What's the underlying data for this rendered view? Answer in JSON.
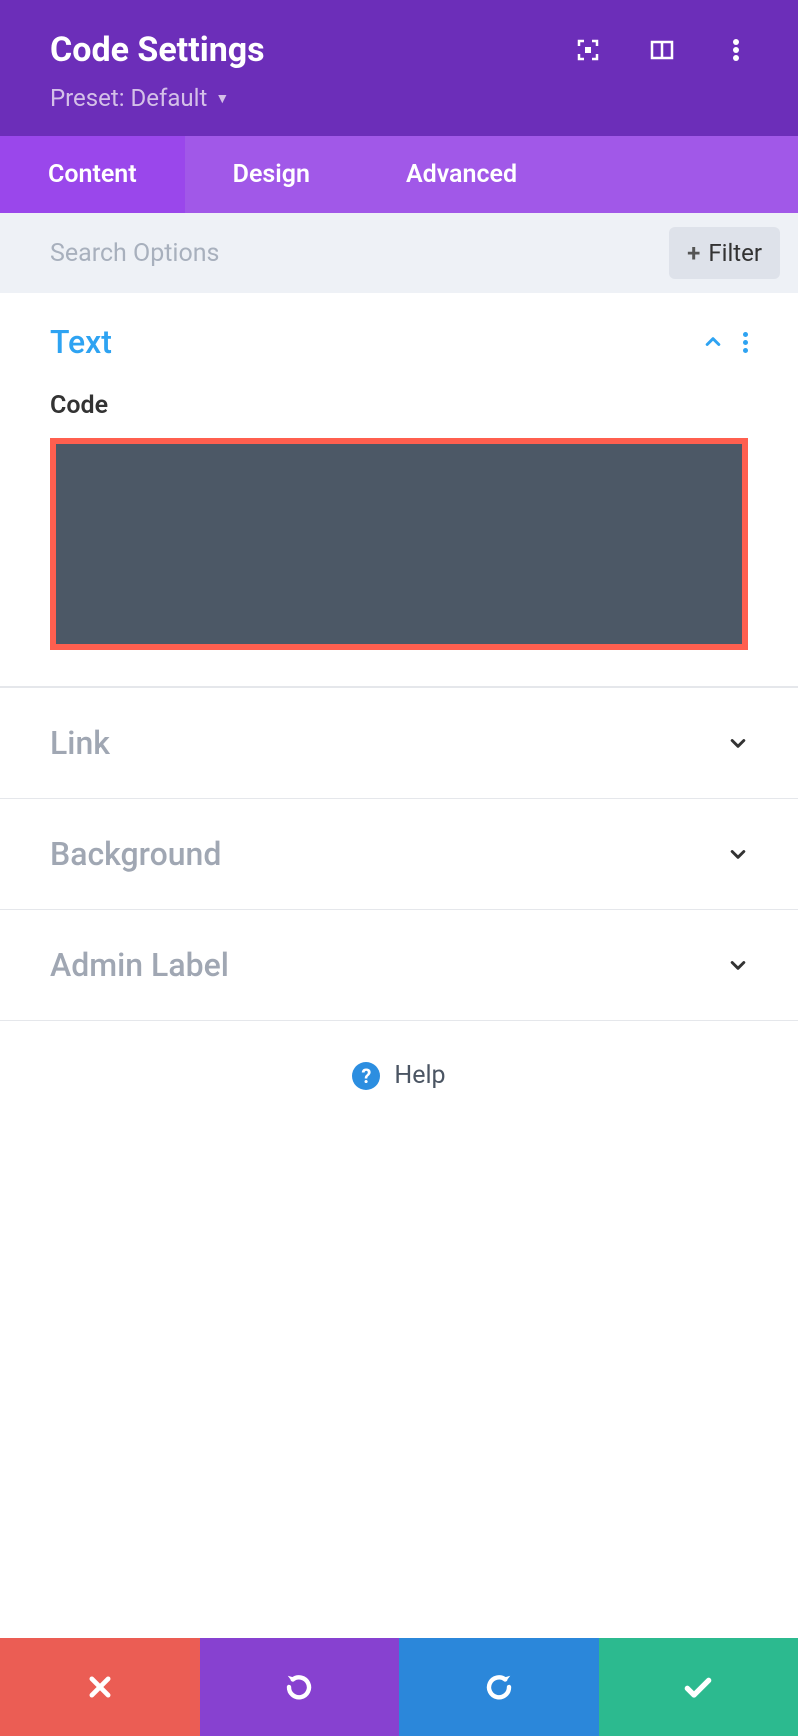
{
  "header": {
    "title": "Code Settings",
    "preset_prefix": "Preset: ",
    "preset_name": "Default"
  },
  "tabs": {
    "content": "Content",
    "design": "Design",
    "advanced": "Advanced"
  },
  "search": {
    "placeholder": "Search Options",
    "filter_label": "Filter"
  },
  "sections": {
    "text": {
      "title": "Text",
      "code_label": "Code"
    },
    "link": {
      "title": "Link"
    },
    "background": {
      "title": "Background"
    },
    "admin_label": {
      "title": "Admin Label"
    }
  },
  "help": {
    "label": "Help"
  },
  "colors": {
    "header_bg": "#6c2eb9",
    "tabs_bg": "#a158e8",
    "active_tab": "#9a47eb",
    "code_border": "#ff5f4f",
    "code_bg": "#4c5866",
    "accent_blue": "#2ea3f2"
  }
}
